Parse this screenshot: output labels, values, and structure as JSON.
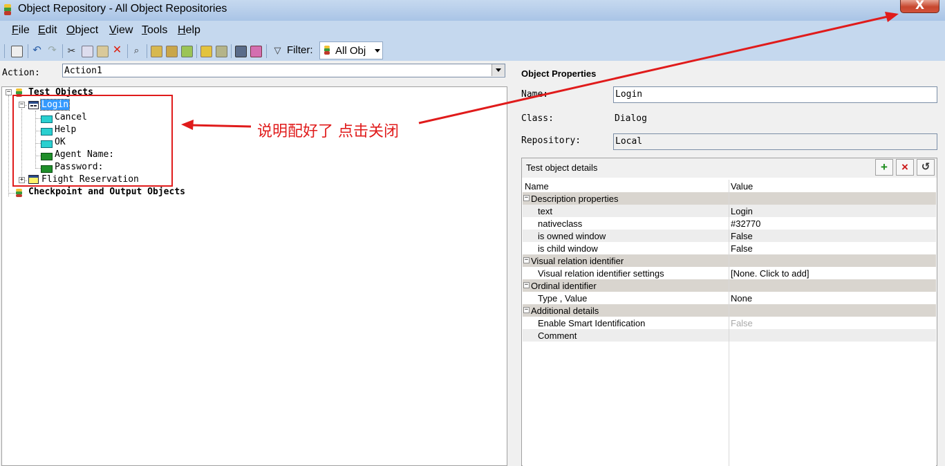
{
  "window": {
    "title": "Object Repository - All Object Repositories",
    "close_glyph": "X"
  },
  "menu": [
    {
      "underline": "F",
      "rest": "ile"
    },
    {
      "underline": "E",
      "rest": "dit"
    },
    {
      "underline": "O",
      "rest": "bject"
    },
    {
      "underline": "V",
      "rest": "iew"
    },
    {
      "underline": "T",
      "rest": "ools"
    },
    {
      "underline": "H",
      "rest": "elp"
    }
  ],
  "toolbar": {
    "filter_label": "Filter:",
    "filter_value": "All Obj"
  },
  "action": {
    "label": "Action:",
    "value": "Action1"
  },
  "tree": {
    "test_objects": "Test Objects",
    "login": "Login",
    "children": [
      "Cancel",
      "Help",
      "OK",
      "Agent Name:",
      "Password:"
    ],
    "flight": "Flight Reservation",
    "checkpoint": "Checkpoint and Output Objects"
  },
  "annotation": {
    "text": "说明配好了 点击关闭"
  },
  "object_properties": {
    "title": "Object Properties",
    "name_label": "Name:",
    "name_value": "Login",
    "class_label": "Class:",
    "class_value": "Dialog",
    "repository_label": "Repository:",
    "repository_value": "Local"
  },
  "details": {
    "title": "Test object details",
    "col_name": "Name",
    "col_value": "Value",
    "rows": [
      {
        "type": "group",
        "name": "Description properties",
        "value": ""
      },
      {
        "type": "item",
        "name": "text",
        "value": "Login"
      },
      {
        "type": "item",
        "name": "nativeclass",
        "value": "#32770"
      },
      {
        "type": "item",
        "name": "is owned window",
        "value": "False"
      },
      {
        "type": "item",
        "name": "is child window",
        "value": "False"
      },
      {
        "type": "group",
        "name": "Visual relation identifier",
        "value": ""
      },
      {
        "type": "item",
        "name": "Visual relation identifier settings",
        "value": "[None. Click to add]"
      },
      {
        "type": "group",
        "name": "Ordinal identifier",
        "value": ""
      },
      {
        "type": "item",
        "name": "Type , Value",
        "value": "None"
      },
      {
        "type": "group",
        "name": "Additional details",
        "value": ""
      },
      {
        "type": "item",
        "name": "Enable Smart Identification",
        "value": "False",
        "disabled": true
      },
      {
        "type": "item",
        "name": "Comment",
        "value": ""
      }
    ]
  },
  "colors": {
    "annotation_red": "#e01b1b",
    "selection_blue": "#3399ff",
    "group_row": "#d9d5cf",
    "alt_row": "#ededed"
  }
}
